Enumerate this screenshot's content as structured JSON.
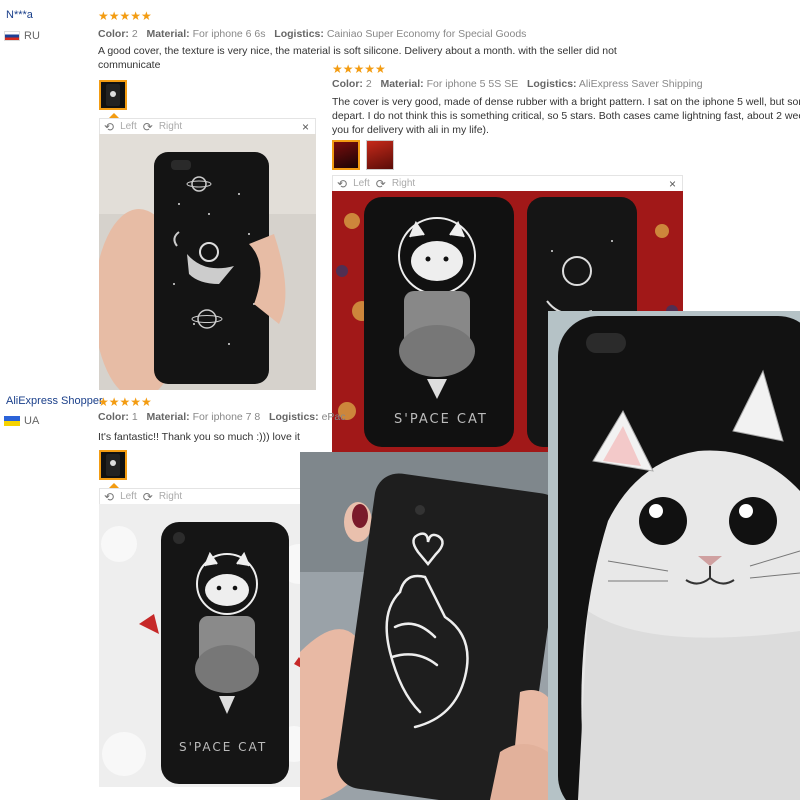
{
  "labels": {
    "color": "Color:",
    "material": "Material:",
    "logistics": "Logistics:",
    "left": "Left",
    "right": "Right",
    "close": "×",
    "star_glyph": "★★★★★"
  },
  "reviews": [
    {
      "name": "N***a",
      "country": "RU",
      "color": "2",
      "material": "For iphone 6 6s",
      "logistics": "Cainiao Super Economy for Special Goods",
      "text": "A good cover, the texture is very nice, the material is soft silicone. Delivery about a month. with the seller did not communicate"
    },
    {
      "color": "2",
      "material": "For iphone 5 5S SE",
      "logistics": "AliExpress Saver Shipping",
      "text": "The cover is very good, made of dense rubber with a bright pattern. I sat on the iphone 5 well, but some edges depart. I do not think this is something critical, so 5 stars. Both cases came lightning fast, about 2 weeks. Thank you for delivery with ali in my life)."
    },
    {
      "name": "AliExpress Shopper",
      "country": "UA",
      "color": "1",
      "material": "For iphone 7 8",
      "logistics": "ePac",
      "text": "It's fantastic!! Thank you so much :))) love it"
    }
  ],
  "photos": {
    "space_cat_caption": "S'PACE CAT"
  },
  "colors": {
    "star": "#f39c12",
    "name": "#1a3f8a",
    "accent": "#f39c12"
  },
  "icons": [
    "rotate-left-icon",
    "rotate-right-icon",
    "close-icon",
    "flag-ru-icon",
    "flag-ua-icon",
    "star-icon"
  ]
}
